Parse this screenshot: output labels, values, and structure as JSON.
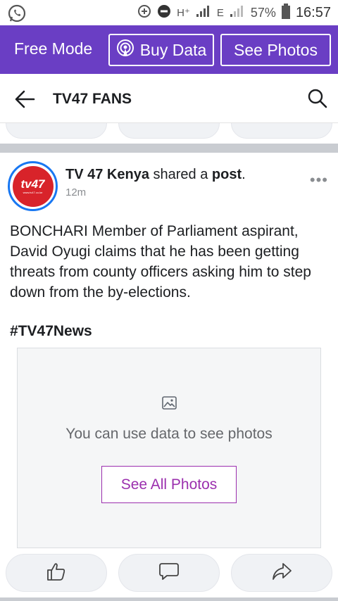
{
  "status_bar": {
    "net_label": "H⁺",
    "net2_label": "E",
    "battery": "57%",
    "time": "16:57"
  },
  "free_mode": {
    "title": "Free Mode",
    "buy_data": "Buy Data",
    "see_photos": "See Photos"
  },
  "header": {
    "title": "TV47 FANS"
  },
  "post": {
    "avatar_logo": "tv47",
    "avatar_url": "www.tv47.co.ke",
    "author": "TV 47 Kenya",
    "action_text": " shared a ",
    "action_object": "post",
    "action_end": ".",
    "time": "12m",
    "more": "•••",
    "body": "BONCHARI Member of Parliament aspirant, David Oyugi claims that he has been getting threats from county officers asking him to step down from the by-elections.",
    "hashtag": "#TV47News",
    "photo_message": "You can use data to see photos",
    "see_all_label": "See All Photos"
  },
  "colors": {
    "accent_purple": "#6a3ec4",
    "link_magenta": "#9b2fae",
    "avatar_ring": "#1877f2",
    "brand_red": "#d8232a"
  },
  "icons": {
    "status_left": "whatsapp-icon",
    "back": "arrow-left-icon",
    "search": "search-icon",
    "photo": "image-icon",
    "like": "thumbs-up-icon",
    "comment": "comment-icon",
    "share": "share-icon"
  }
}
